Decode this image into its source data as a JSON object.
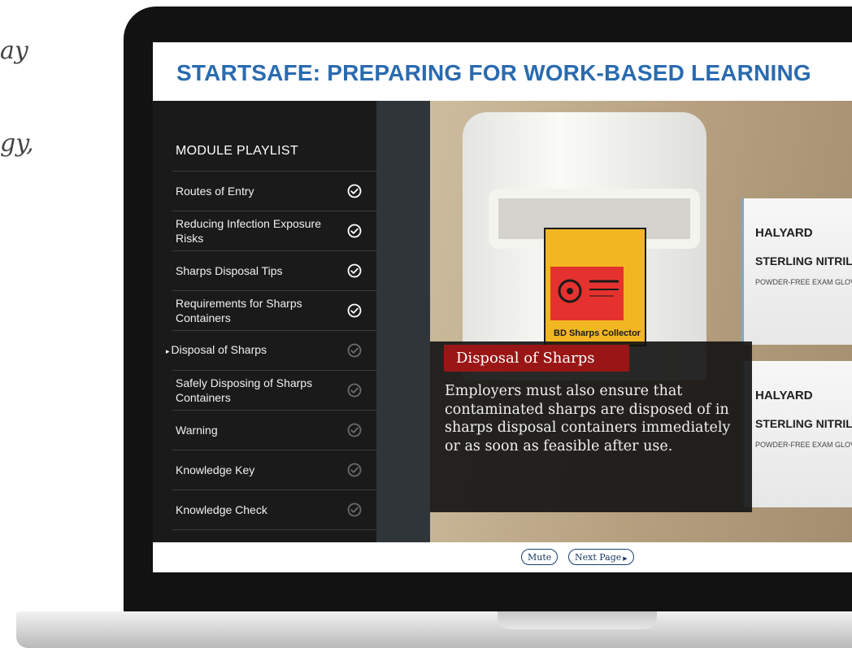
{
  "background": {
    "partial_text_1": "ay",
    "partial_text_2": "gy,"
  },
  "course": {
    "title": "STARTSAFE: PREPARING FOR WORK-BASED LEARNING"
  },
  "playlist": {
    "heading": "MODULE PLAYLIST",
    "items": [
      {
        "label": "Routes of Entry",
        "completed": true
      },
      {
        "label": "Reducing Infection Exposure Risks",
        "completed": true
      },
      {
        "label": "Sharps Disposal Tips",
        "completed": true
      },
      {
        "label": "Requirements for Sharps Containers",
        "completed": true
      },
      {
        "label": "Disposal of Sharps",
        "completed": false,
        "current": true
      },
      {
        "label": "Safely Disposing of Sharps Containers",
        "completed": false
      },
      {
        "label": "Warning",
        "completed": false
      },
      {
        "label": "Knowledge Key",
        "completed": false
      },
      {
        "label": "Knowledge Check",
        "completed": false
      }
    ],
    "current_marker": "▸"
  },
  "media": {
    "label_text": "BD Sharps Collector",
    "dispenser_brand": "HALYARD",
    "dispenser_product": "STERLING NITRILE",
    "dispenser_subtext": "POWDER-FREE EXAM GLOVES"
  },
  "caption": {
    "title": "Disposal of Sharps",
    "body": "Employers must also ensure that contaminated sharps are disposed of in sharps disposal containers immediately or as soon as feasible after use."
  },
  "controls": {
    "mute_label": "Mute",
    "next_label": "Next Page"
  },
  "colors": {
    "title_blue": "#2a6bb0",
    "playlist_bg": "#1a1a1a",
    "caption_title_bg": "#9a1616",
    "check_completed": "#ffffff",
    "check_pending": "#6b6b6b"
  }
}
